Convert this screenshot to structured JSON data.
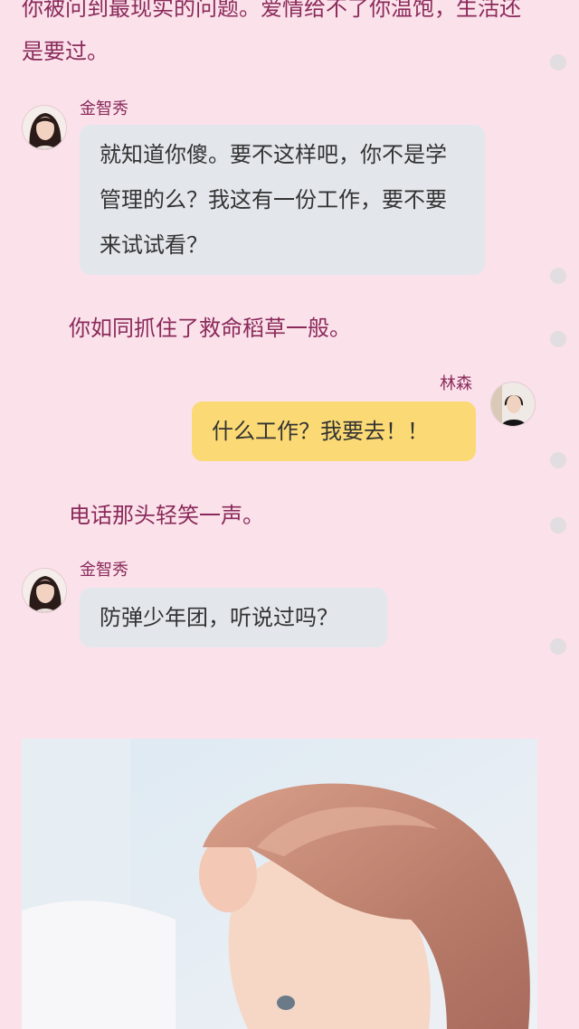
{
  "story": {
    "narration_1": "你被问到最现实的问题。爱情给不了你温饱，生活还是要过。",
    "narration_2": "你如同抓住了救命稻草一般。",
    "narration_3": "电话那头轻笑一声。"
  },
  "messages": [
    {
      "sender": "金智秀",
      "side": "left",
      "text": "就知道你傻。要不这样吧，你不是学管理的么？我这有一份工作，要不要来试试看？"
    },
    {
      "sender": "林森",
      "side": "right",
      "text": "什么工作？我要去！！"
    },
    {
      "sender": "金智秀",
      "side": "left",
      "text": "防弹少年团，听说过吗？"
    }
  ],
  "colors": {
    "background": "#fbe1ea",
    "narration_text": "#8a2a5a",
    "left_bubble": "#e3e7ec",
    "right_bubble": "#fbd974"
  },
  "icons": {
    "avatar_left": "avatar-woman-long-hair",
    "avatar_right": "avatar-woman-dark-top",
    "scroll_dot": "dot-icon"
  }
}
